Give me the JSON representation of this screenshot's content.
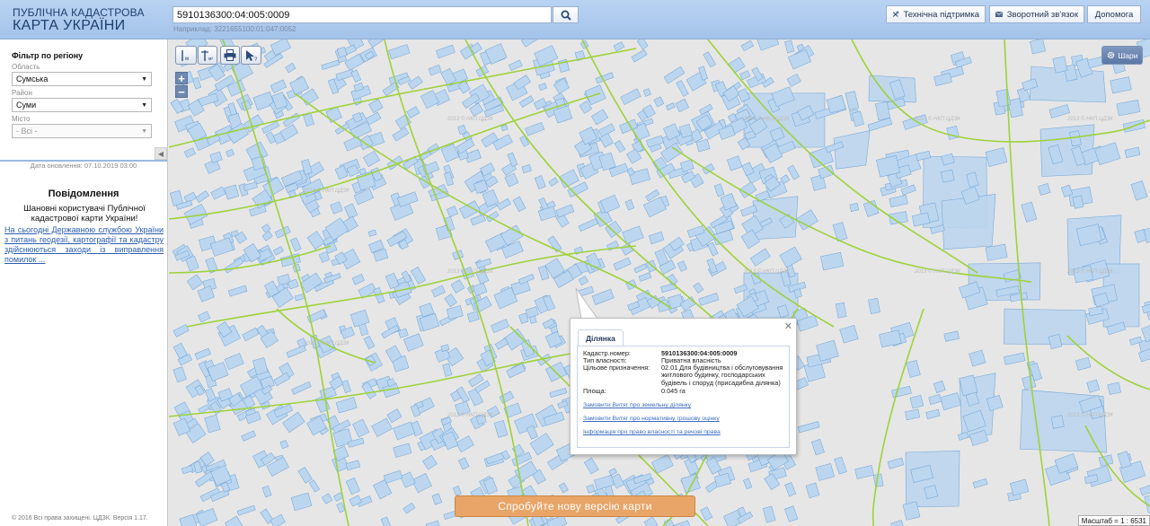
{
  "header": {
    "logo_line1": "ПУБЛІЧНА КАДАСТРОВА",
    "logo_line2": "КАРТА УКРАЇНИ",
    "search_value": "5910136300:04:005:0009",
    "search_hint": "Наприклад: 3221655100:01:047:0052",
    "tech_support": "Технічна підтримка",
    "feedback": "Зворотний зв'язок",
    "help": "Допомога"
  },
  "filter": {
    "title": "Фільтр по регіону",
    "oblast_label": "Область",
    "oblast_value": "Сумська",
    "rayon_label": "Район",
    "rayon_value": "Суми",
    "misto_label": "Місто",
    "misto_value": "- Всі -"
  },
  "update_date": "Дата оновлення: 07.10.2019 03:00",
  "notice": {
    "title": "Повідомлення",
    "text": "Шановні користувачі Публічної кадастрової карти України!",
    "link": "На сьогодні Державною службою України з питань геодезії, картографії та кадастру здійснюються заходи із виправлення помилок ..."
  },
  "copyright": "© 2016 Всі права захищені. ЦДЗК. Версія 1.17.",
  "map": {
    "layers_label": "Шари",
    "zoom_in": "+",
    "zoom_out": "−",
    "new_version": "Спробуйте нову версію карти",
    "scale": "Масштаб = 1 : 6531"
  },
  "popup": {
    "tab": "Ділянка",
    "rows": [
      {
        "k": "Кадастр.номер:",
        "v": "5910136300:04:005:0009"
      },
      {
        "k": "Тип власності:",
        "v": "Приватна власність"
      },
      {
        "k": "Цільове призначення:",
        "v": "02.01 Для будівництва і обслуговування житлового будинку, господарських будівель і споруд (присадибна ділянка)"
      },
      {
        "k": "Площа:",
        "v": "0.045 га"
      }
    ],
    "link1": "Замовити Витяг про земельну ділянку",
    "link2": "Замовити Витяг про нормативну грошову оцінку",
    "link3": "Інформація про право власності та речові права"
  },
  "colors": {
    "parcel_fill": "#bcd6ef",
    "parcel_stroke": "#6ea3d6",
    "road": "#9ed23a",
    "map_bg": "#e6e6e6",
    "header": "#a9c6ec",
    "new_version_bg": "#e8a567"
  }
}
